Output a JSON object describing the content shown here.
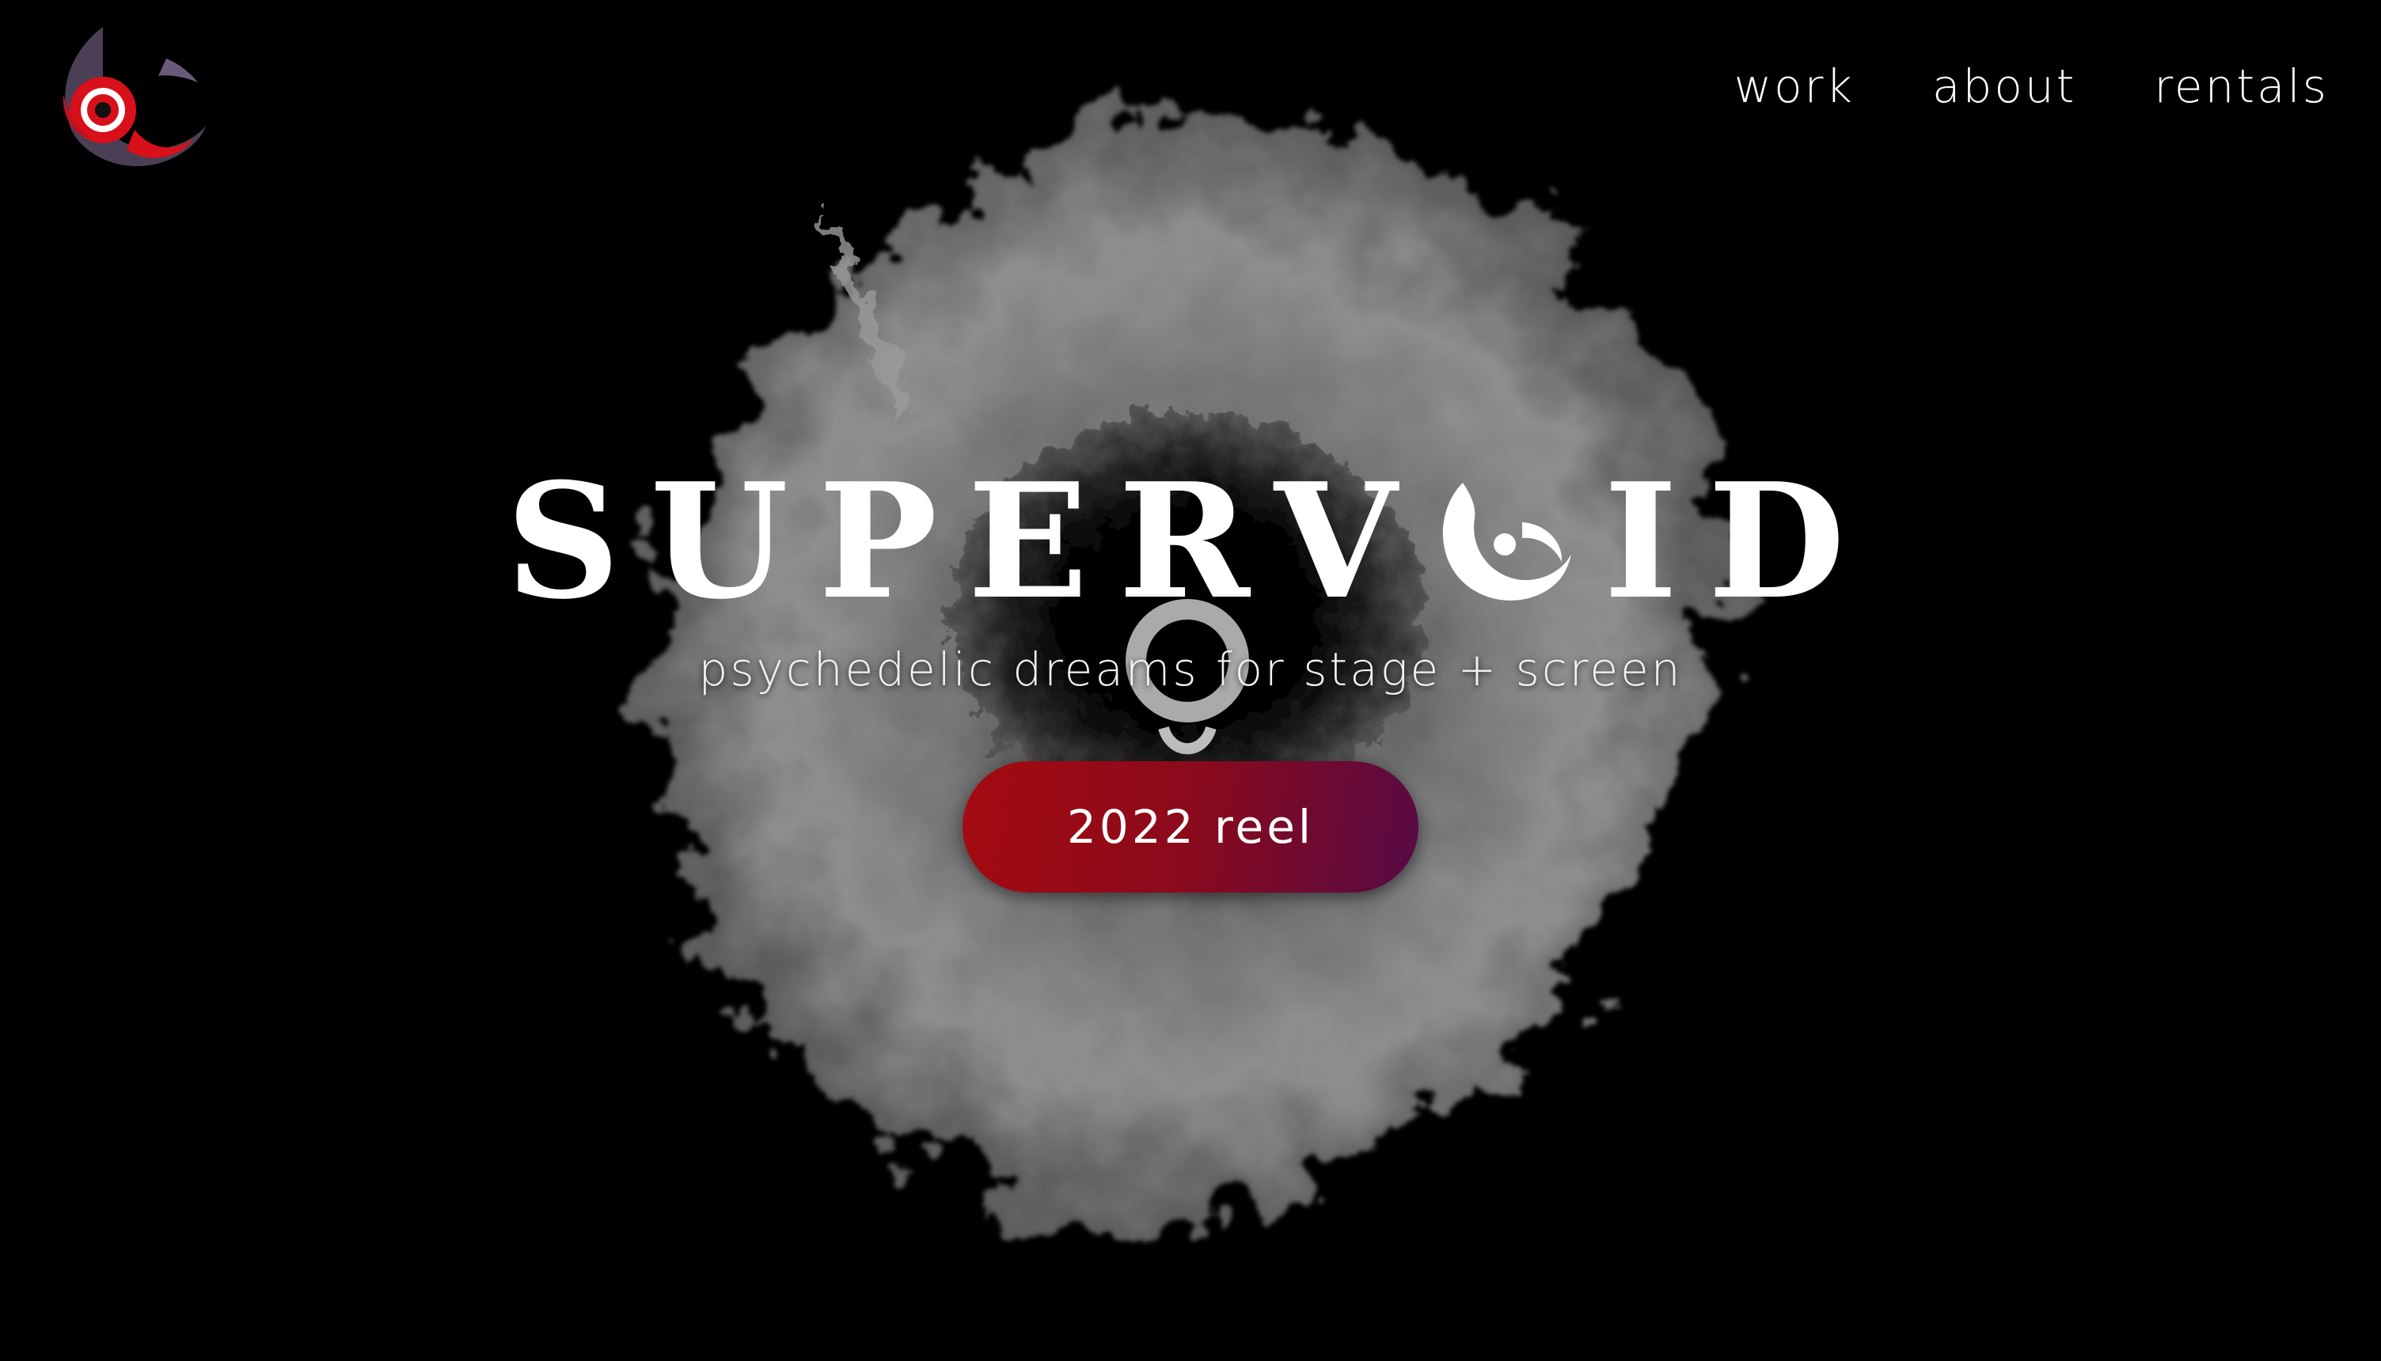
{
  "brand": {
    "logo_icon": "supervoid-eye-logo-icon",
    "title": "SUPERVOID",
    "title_parts": {
      "before": "SUPERV",
      "after": "ID"
    },
    "subtitle": "psychedelic dreams for stage + screen"
  },
  "nav": {
    "items": [
      {
        "label": "work"
      },
      {
        "label": "about"
      },
      {
        "label": "rentals"
      }
    ]
  },
  "hero": {
    "background_icon": "smoke-eye-artwork",
    "cta_label": "2022 reel"
  },
  "colors": {
    "background": "#000000",
    "text": "#ffffff",
    "accent_red": "#a50a10",
    "accent_purple": "#560a45",
    "smoke_gray": "#8a8a8a"
  }
}
